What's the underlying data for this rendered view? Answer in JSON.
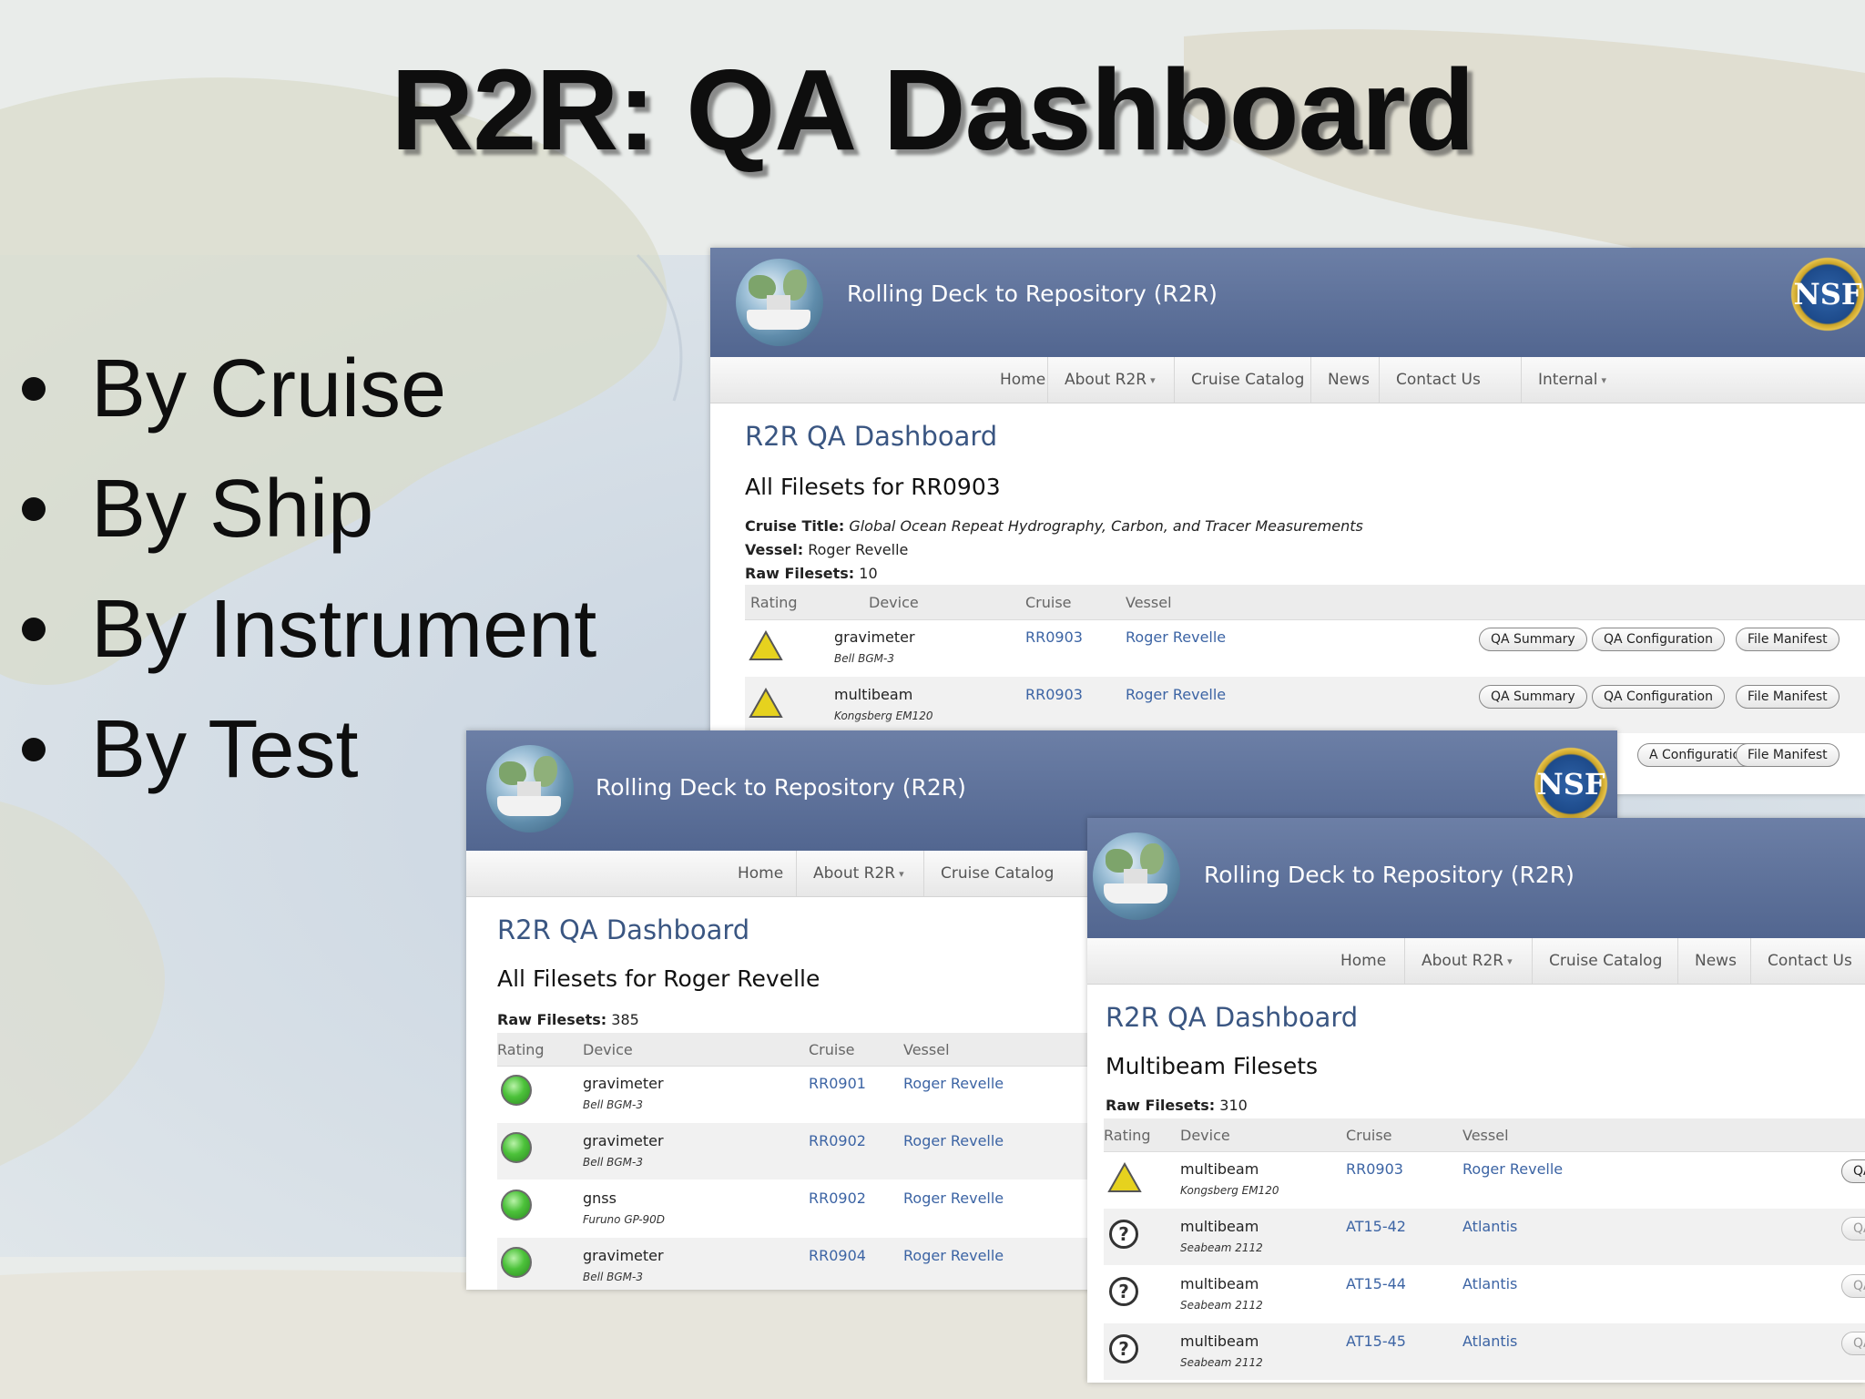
{
  "slide": {
    "title": "R2R: QA Dashboard",
    "bullets": [
      "By Cruise",
      "By Ship",
      "By Instrument",
      "By Test"
    ]
  },
  "site": {
    "title": "Rolling Deck to Repository (R2R)",
    "nsf_logo": "NSF",
    "nav": {
      "home": "Home",
      "about": "About R2R",
      "catalog": "Cruise Catalog",
      "news": "News",
      "contact": "Contact Us",
      "internal": "Internal"
    },
    "dashboard_title": "R2R QA Dashboard",
    "columns": {
      "rating": "Rating",
      "device": "Device",
      "cruise": "Cruise",
      "vessel": "Vessel"
    },
    "buttons": {
      "qa_summary": "QA Summary",
      "qa_config": "QA Configuration",
      "file_manifest": "File Manifest",
      "qa_short": "QA",
      "qa_config_partial": "A Configuration"
    }
  },
  "by_cruise": {
    "subtitle": "All Filesets for RR0903",
    "cruise_title_label": "Cruise Title:",
    "cruise_title": "Global Ocean Repeat Hydrography, Carbon, and Tracer Measurements",
    "vessel_label": "Vessel:",
    "vessel": "Roger Revelle",
    "raw_label": "Raw Filesets:",
    "raw_count": "10",
    "rows": [
      {
        "rating": "warning-icon",
        "device": "gravimeter",
        "model": "Bell BGM-3",
        "cruise": "RR0903",
        "vessel": "Roger Revelle"
      },
      {
        "rating": "warning-icon",
        "device": "multibeam",
        "model": "Kongsberg EM120",
        "cruise": "RR0903",
        "vessel": "Roger Revelle"
      }
    ]
  },
  "by_ship": {
    "subtitle": "All Filesets for Roger Revelle",
    "raw_label": "Raw Filesets:",
    "raw_count": "385",
    "rows": [
      {
        "rating": "pass-icon",
        "device": "gravimeter",
        "model": "Bell BGM-3",
        "cruise": "RR0901",
        "vessel": "Roger Revelle"
      },
      {
        "rating": "pass-icon",
        "device": "gravimeter",
        "model": "Bell BGM-3",
        "cruise": "RR0902",
        "vessel": "Roger Revelle"
      },
      {
        "rating": "pass-icon",
        "device": "gnss",
        "model": "Furuno GP-90D",
        "cruise": "RR0902",
        "vessel": "Roger Revelle"
      },
      {
        "rating": "pass-icon",
        "device": "gravimeter",
        "model": "Bell BGM-3",
        "cruise": "RR0904",
        "vessel": "Roger Revelle"
      }
    ]
  },
  "by_instrument": {
    "subtitle": "Multibeam Filesets",
    "raw_label": "Raw Filesets:",
    "raw_count": "310",
    "rows": [
      {
        "rating": "warning-icon",
        "device": "multibeam",
        "model": "Kongsberg EM120",
        "cruise": "RR0903",
        "vessel": "Roger Revelle"
      },
      {
        "rating": "unknown-icon",
        "device": "multibeam",
        "model": "Seabeam 2112",
        "cruise": "AT15-42",
        "vessel": "Atlantis"
      },
      {
        "rating": "unknown-icon",
        "device": "multibeam",
        "model": "Seabeam 2112",
        "cruise": "AT15-44",
        "vessel": "Atlantis"
      },
      {
        "rating": "unknown-icon",
        "device": "multibeam",
        "model": "Seabeam 2112",
        "cruise": "AT15-45",
        "vessel": "Atlantis"
      }
    ]
  },
  "colors": {
    "header": "#5d7099",
    "link": "#3c64a4",
    "dashboard_title": "#3a5682",
    "warning": "#e6d21e",
    "pass": "#4cc23a"
  }
}
